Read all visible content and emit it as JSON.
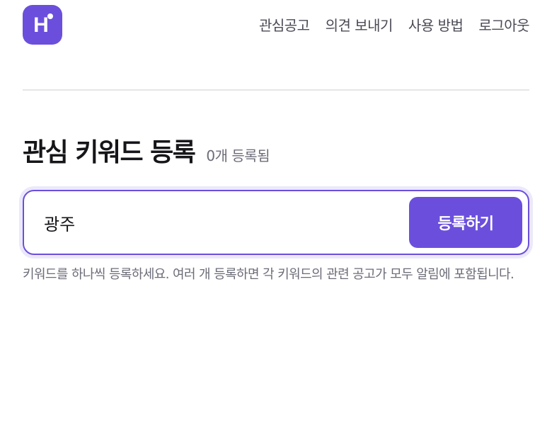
{
  "header": {
    "logo_letter": "H",
    "nav": [
      {
        "label": "관심공고"
      },
      {
        "label": "의견 보내기"
      },
      {
        "label": "사용 방법"
      },
      {
        "label": "로그아웃"
      }
    ]
  },
  "main": {
    "title": "관심 키워드 등록",
    "count_label": "0개 등록됨",
    "keyword_input": {
      "value": "광주"
    },
    "register_button_label": "등록하기",
    "help_text": "키워드를 하나씩 등록하세요. 여러 개 등록하면 각 키워드의 관련 공고가 모두 알림에 포함됩니다."
  },
  "colors": {
    "accent": "#6b4fdc",
    "focus_ring": "#ece8fb"
  }
}
